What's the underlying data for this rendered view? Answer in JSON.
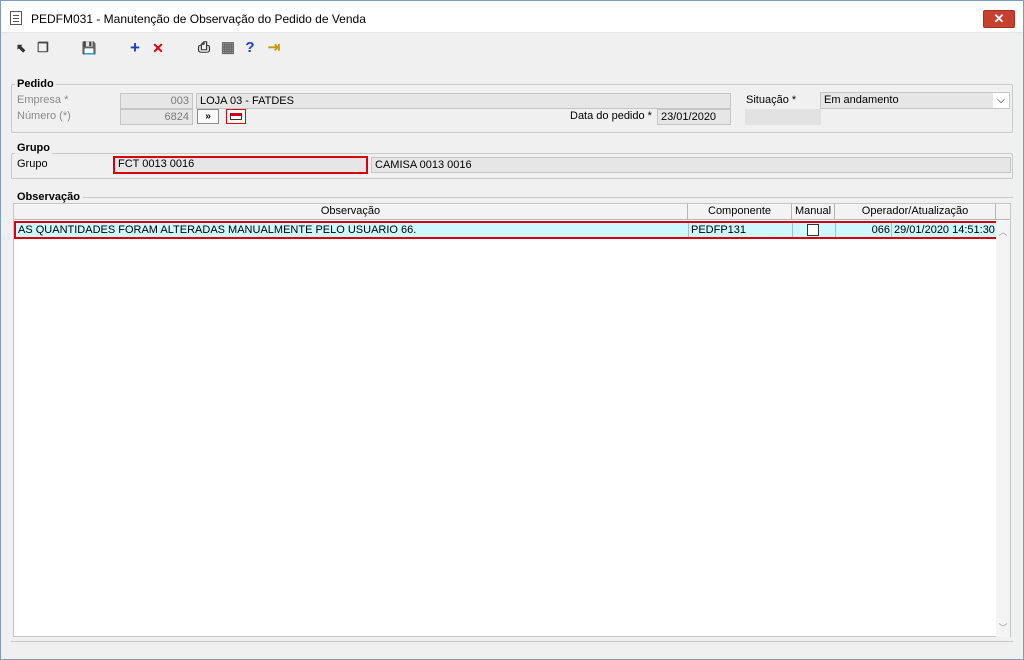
{
  "window": {
    "title": "PEDFM031 - Manutenção de Observação do Pedido de Venda",
    "close_glyph": "✕"
  },
  "toolbar": {
    "items": [
      {
        "name": "first-icon",
        "glyph": "⬉"
      },
      {
        "name": "copy-icon",
        "glyph": "❐"
      },
      {
        "name": "save-icon",
        "glyph": "💾"
      },
      {
        "name": "add-icon",
        "glyph": "+"
      },
      {
        "name": "delete-icon",
        "glyph": "✕"
      },
      {
        "name": "print-icon",
        "glyph": "⎙"
      },
      {
        "name": "grid-icon",
        "glyph": "▦"
      },
      {
        "name": "help-icon",
        "glyph": "?"
      },
      {
        "name": "exit-icon",
        "glyph": "⇥"
      }
    ]
  },
  "pedido": {
    "section_label": "Pedido",
    "empresa_label": "Empresa *",
    "empresa_code": "003",
    "empresa_name": "LOJA 03 - FATDES",
    "numero_label": "Número (*)",
    "numero_value": "6824",
    "next_button": "»",
    "data_label": "Data do pedido *",
    "data_value": "23/01/2020",
    "situacao_label": "Situação *",
    "situacao_value": "Em andamento"
  },
  "grupo": {
    "section_label": "Grupo",
    "field_label": "Grupo",
    "code": "FCT 0013 0016",
    "description": "CAMISA 0013 0016"
  },
  "observacao": {
    "section_label": "Observação",
    "columns": [
      "Observação",
      "Componente",
      "Manual",
      "Operador/Atualização"
    ],
    "rows": [
      {
        "observacao": "AS QUANTIDADES FORAM ALTERADAS MANUALMENTE PELO USUARIO 66.",
        "componente": "PEDFP131",
        "manual": false,
        "operador": "066",
        "atualizacao": "29/01/2020 14:51:30"
      }
    ]
  },
  "colors": {
    "selection_row": "#cdf8ff",
    "highlight_border": "#d9000d",
    "close_button": "#c7402f"
  }
}
